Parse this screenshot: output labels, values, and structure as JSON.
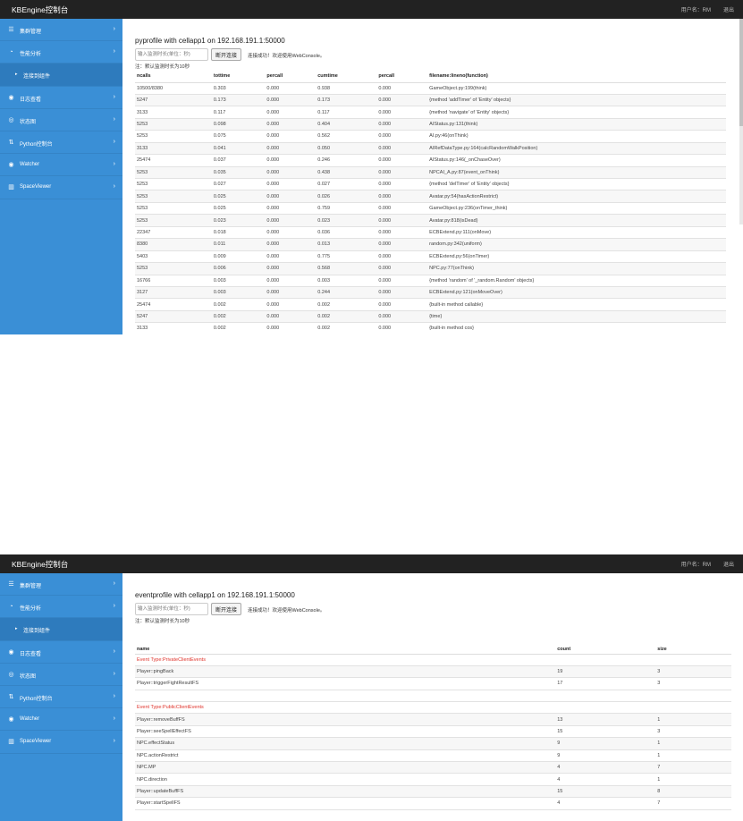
{
  "app": {
    "brand": "KBEngine控制台",
    "user": "用户名：RM",
    "logout": "退出"
  },
  "sidebar": {
    "items": [
      {
        "label": "集群管理",
        "icon": "server-icon"
      },
      {
        "label": "性能分析",
        "icon": "chart-icon"
      },
      {
        "label": "日志查看",
        "icon": "log-icon"
      },
      {
        "label": "状态图",
        "icon": "status-icon"
      },
      {
        "label": "Python控制台",
        "icon": "terminal-icon"
      },
      {
        "label": "Watcher",
        "icon": "eye-icon"
      },
      {
        "label": "SpaceViewer",
        "icon": "grid-icon"
      }
    ],
    "sub_item": "连接到组件"
  },
  "screen1": {
    "title": "pyprofile with cellapp1 on 192.168.191.1:50000",
    "input_placeholder": "输入监测时长(单位：秒)",
    "button": "断开连接",
    "status": "连接成功！欢迎使用WebConsole。",
    "note": "注：默认监测时长为10秒",
    "columns": [
      "ncalls",
      "tottime",
      "percall",
      "cumtime",
      "percall",
      "filename:lineno(function)"
    ],
    "rows": [
      [
        "10500/8380",
        "0.303",
        "0.000",
        "0.938",
        "0.000",
        "GameObject.py:199(think)"
      ],
      [
        "5247",
        "0.173",
        "0.000",
        "0.173",
        "0.000",
        "{method 'addTimer' of 'Entity' objects}"
      ],
      [
        "3133",
        "0.117",
        "0.000",
        "0.117",
        "0.000",
        "{method 'navigate' of 'Entity' objects}"
      ],
      [
        "5253",
        "0.098",
        "0.000",
        "0.404",
        "0.000",
        "AIStatus.py:131(think)"
      ],
      [
        "5253",
        "0.075",
        "0.000",
        "0.562",
        "0.000",
        "AI.py:46(onThink)"
      ],
      [
        "3133",
        "0.041",
        "0.000",
        "0.050",
        "0.000",
        "AIRefDataType.py:164(calcRandomWalkPosition)"
      ],
      [
        "25474",
        "0.037",
        "0.000",
        "0.246",
        "0.000",
        "AIStatus.py:146(_onChaseOver)"
      ],
      [
        "5253",
        "0.035",
        "0.000",
        "0.438",
        "0.000",
        "NPCAI_A.py:87(event_onThink)"
      ],
      [
        "5253",
        "0.027",
        "0.000",
        "0.027",
        "0.000",
        "{method 'delTimer' of 'Entity' objects}"
      ],
      [
        "5253",
        "0.025",
        "0.000",
        "0.026",
        "0.000",
        "Avatar.py:54(hasActionRestrict)"
      ],
      [
        "5253",
        "0.025",
        "0.000",
        "0.759",
        "0.000",
        "GameObject.py:236(onTimer_think)"
      ],
      [
        "5253",
        "0.023",
        "0.000",
        "0.023",
        "0.000",
        "Avatar.py:818(isDead)"
      ],
      [
        "22347",
        "0.018",
        "0.000",
        "0.036",
        "0.000",
        "ECBExtend.py:111(onMove)"
      ],
      [
        "8380",
        "0.011",
        "0.000",
        "0.013",
        "0.000",
        "random.py:342(uniform)"
      ],
      [
        "5403",
        "0.009",
        "0.000",
        "0.775",
        "0.000",
        "ECBExtend.py:56(onTimer)"
      ],
      [
        "5253",
        "0.006",
        "0.000",
        "0.568",
        "0.000",
        "NPC.py:77(onThink)"
      ],
      [
        "16766",
        "0.003",
        "0.000",
        "0.003",
        "0.000",
        "{method 'random' of '_random.Random' objects}"
      ],
      [
        "3127",
        "0.003",
        "0.000",
        "0.244",
        "0.000",
        "ECBExtend.py:121(onMoveOver)"
      ],
      [
        "25474",
        "0.002",
        "0.000",
        "0.002",
        "0.000",
        "{built-in method callable}"
      ],
      [
        "5247",
        "0.002",
        "0.000",
        "0.002",
        "0.000",
        "{time}"
      ],
      [
        "3133",
        "0.002",
        "0.000",
        "0.002",
        "0.000",
        "{built-in method cos}"
      ]
    ]
  },
  "screen2": {
    "title": "eventprofile with cellapp1 on 192.168.191.1:50000",
    "input_placeholder": "输入监测时长(单位：秒)",
    "button": "断开连接",
    "status": "连接成功！欢迎使用WebConsole。",
    "note": "注：默认监测时长为10秒",
    "columns": [
      "name",
      "count",
      "size"
    ],
    "groups": [
      {
        "type": "Event Type:PrivateClientEvents",
        "rows": [
          [
            "Player::pingBack",
            "19",
            "3"
          ],
          [
            "Player::triggerFightResultFS",
            "17",
            "3"
          ]
        ]
      },
      {
        "type": "Event Type:PublicClientEvents",
        "rows": [
          [
            "Player::removeBuffFS",
            "13",
            "1"
          ],
          [
            "Player::seeSpellEffectFS",
            "15",
            "3"
          ],
          [
            "NPC.effectStatus",
            "9",
            "1"
          ],
          [
            "NPC.actionRestrict",
            "9",
            "1"
          ],
          [
            "NPC.MP",
            "4",
            "7"
          ],
          [
            "NPC.direction",
            "4",
            "1"
          ],
          [
            "Player::updateBuffFS",
            "15",
            "8"
          ],
          [
            "Player::startSpellFS",
            "4",
            "7"
          ]
        ]
      }
    ]
  }
}
